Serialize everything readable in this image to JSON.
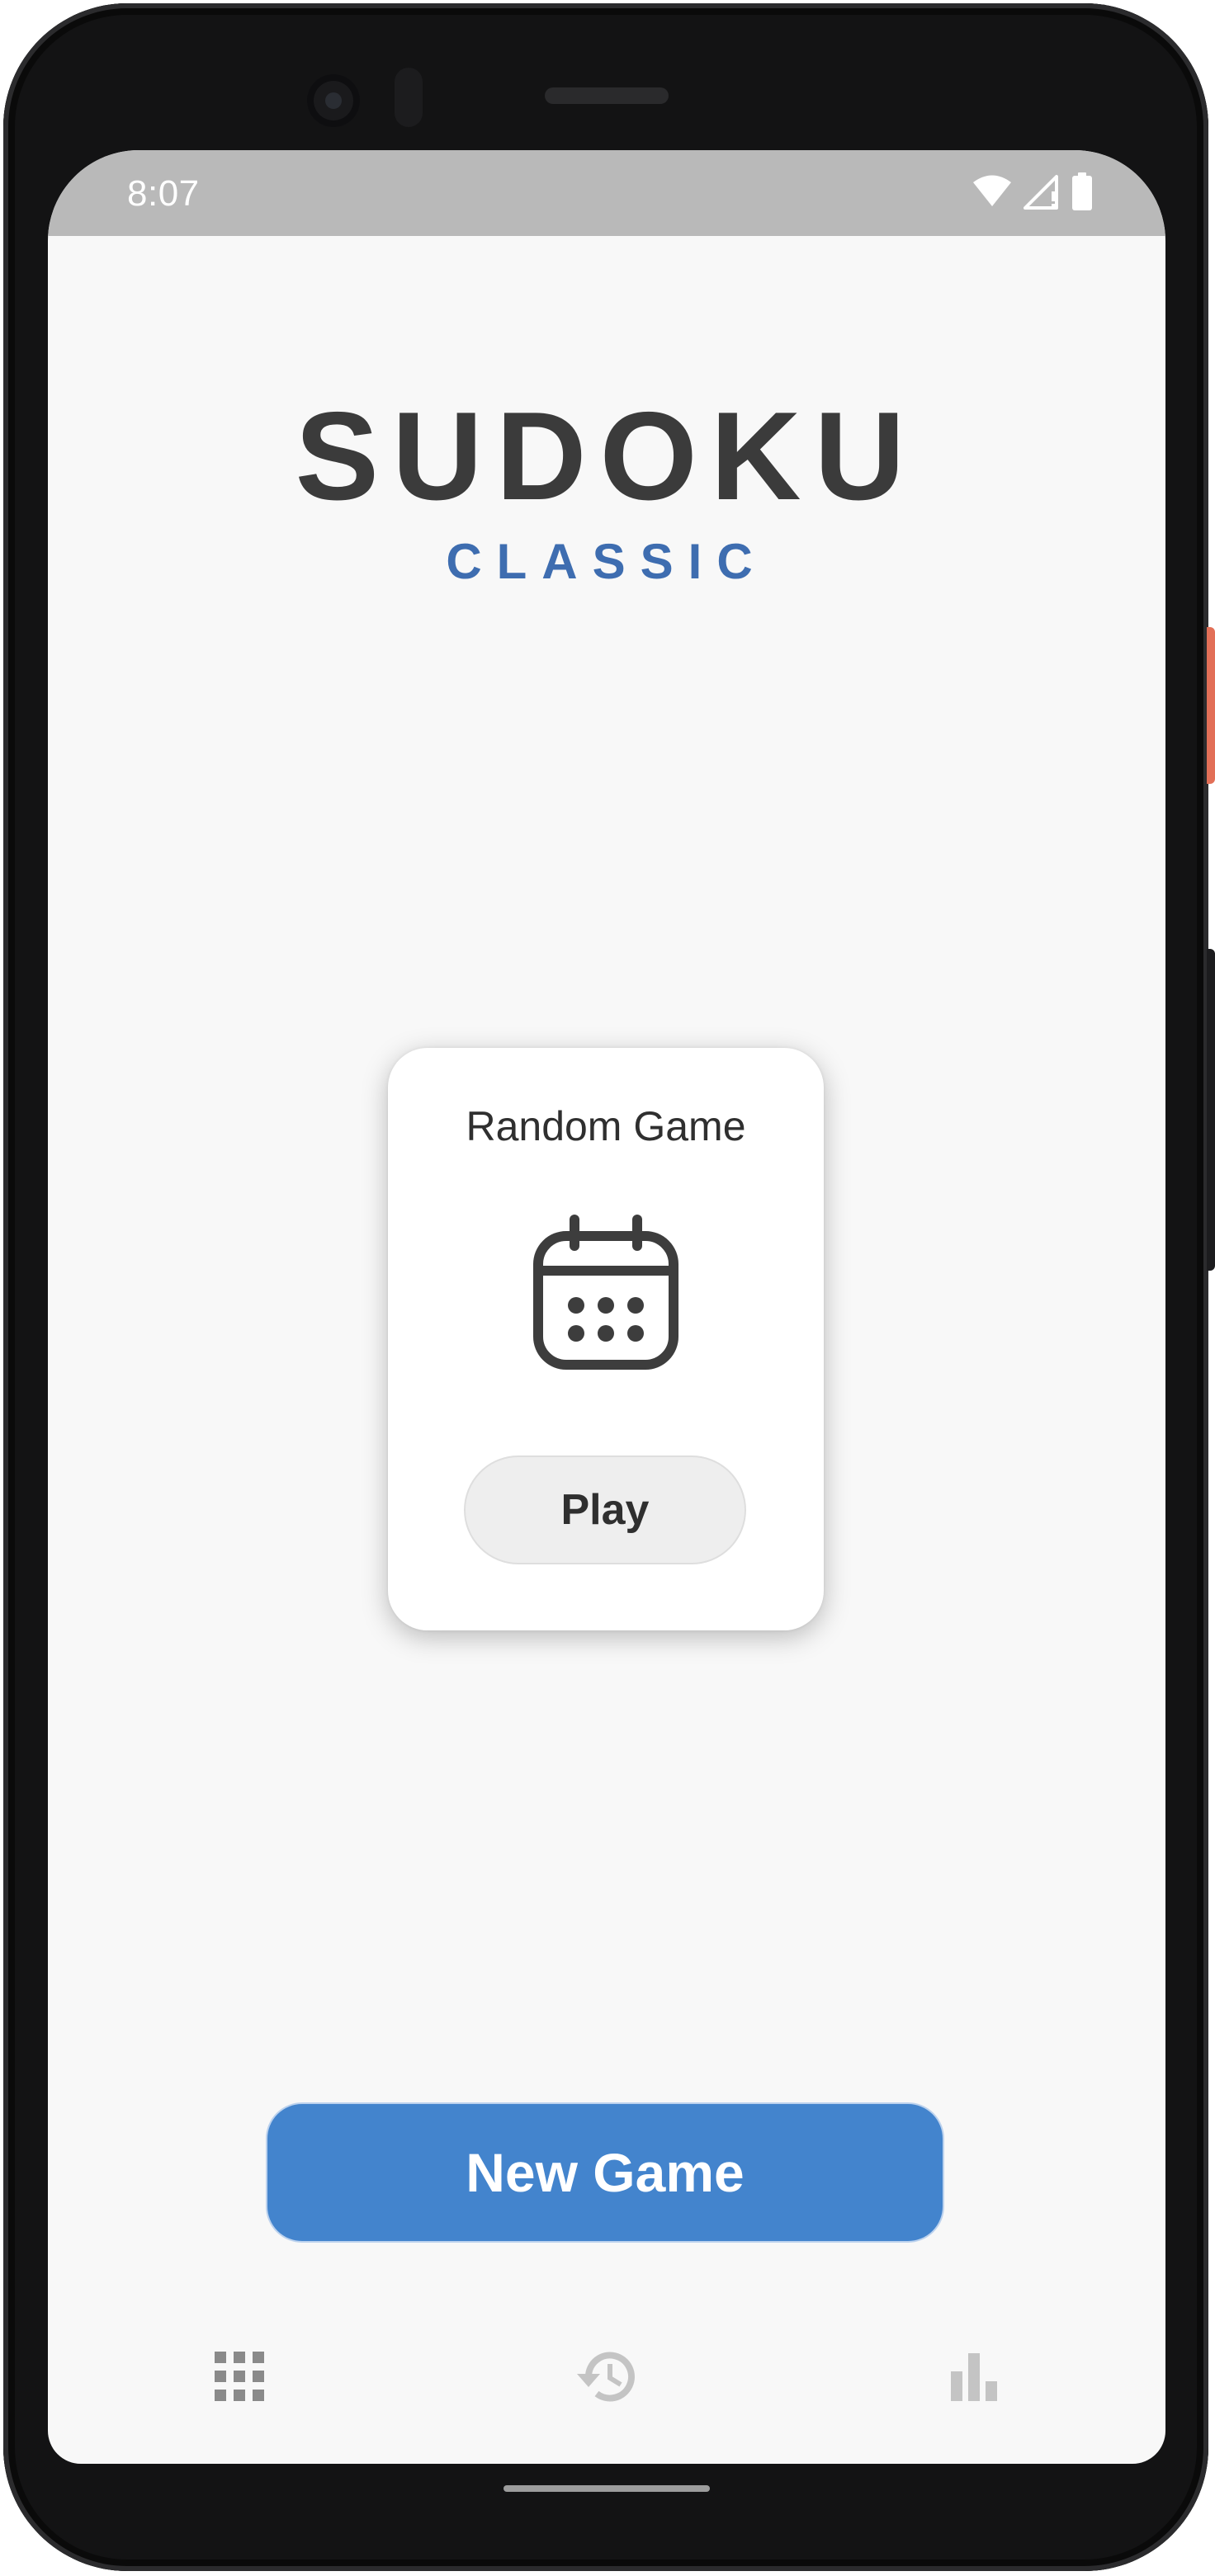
{
  "status_bar": {
    "time": "8:07",
    "icons": [
      "wifi-icon",
      "signal-icon",
      "battery-icon"
    ]
  },
  "app": {
    "title": "SUDOKU",
    "subtitle": "CLASSIC"
  },
  "random_card": {
    "title": "Random Game",
    "icon": "calendar-icon",
    "play_label": "Play"
  },
  "actions": {
    "new_game_label": "New Game"
  },
  "bottom_nav": {
    "items": [
      {
        "icon": "grid-icon"
      },
      {
        "icon": "history-icon"
      },
      {
        "icon": "stats-icon"
      }
    ]
  },
  "colors": {
    "accent": "#4384cd",
    "subtitle": "#3e6db0",
    "text": "#3b3b3b",
    "nav_active": "#8a8a8a",
    "nav_inactive": "#c4c4c4"
  }
}
